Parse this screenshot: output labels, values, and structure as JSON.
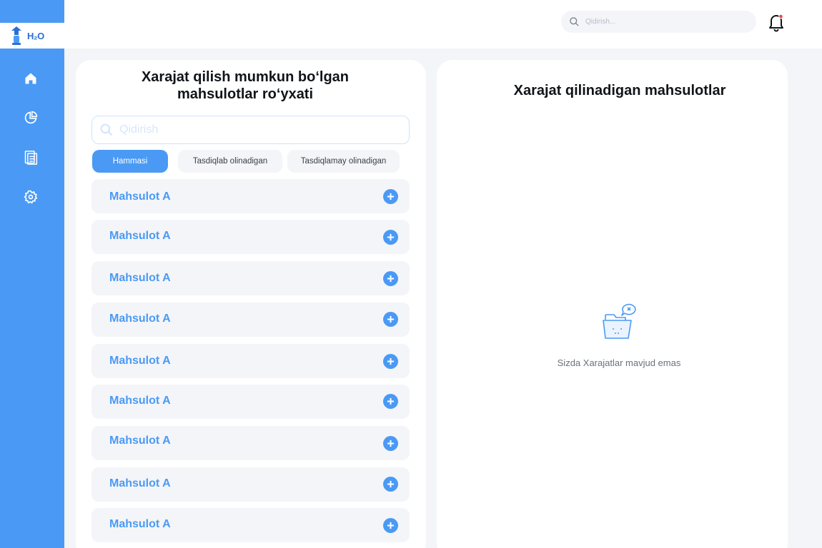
{
  "app": {
    "logo_text": "H₂O"
  },
  "sidebar": {
    "items": [
      {
        "name": "home",
        "icon": "home-icon"
      },
      {
        "name": "statistics",
        "icon": "pie-chart-icon"
      },
      {
        "name": "reports",
        "icon": "report-icon"
      },
      {
        "name": "settings",
        "icon": "gear-icon"
      }
    ]
  },
  "header": {
    "search_placeholder": "Qidirish...",
    "bell_icon": "bell-icon",
    "notification_dot_color": "#ef4444"
  },
  "left_panel": {
    "title_line1": "Xarajat qilish mumkun bo‘lgan",
    "title_line2": "mahsulotlar ro‘yxati",
    "search_placeholder": "Qidirish",
    "tabs": [
      {
        "label": "Hammasi",
        "active": true
      },
      {
        "label": "Tasdiqlab olinadigan",
        "active": false
      },
      {
        "label": "Tasdiqlamay olinadigan",
        "active": false
      }
    ],
    "items": [
      {
        "name": "Mahsulot A"
      },
      {
        "name": "Mahsulot A"
      },
      {
        "name": "Mahsulot A"
      },
      {
        "name": "Mahsulot A"
      },
      {
        "name": "Mahsulot A"
      },
      {
        "name": "Mahsulot A"
      },
      {
        "name": "Mahsulot A"
      },
      {
        "name": "Mahsulot A"
      },
      {
        "name": "Mahsulot A"
      }
    ]
  },
  "right_panel": {
    "title": "Xarajat qilinadigan mahsulotlar",
    "empty_icon": "empty-folder-icon",
    "empty_text": "Sizda Xarajatlar mavjud emas"
  },
  "colors": {
    "accent": "#4a9af5",
    "background": "#f4f5f8",
    "card": "#ffffff",
    "text_dark": "#111418",
    "text_muted": "#6b717c"
  }
}
